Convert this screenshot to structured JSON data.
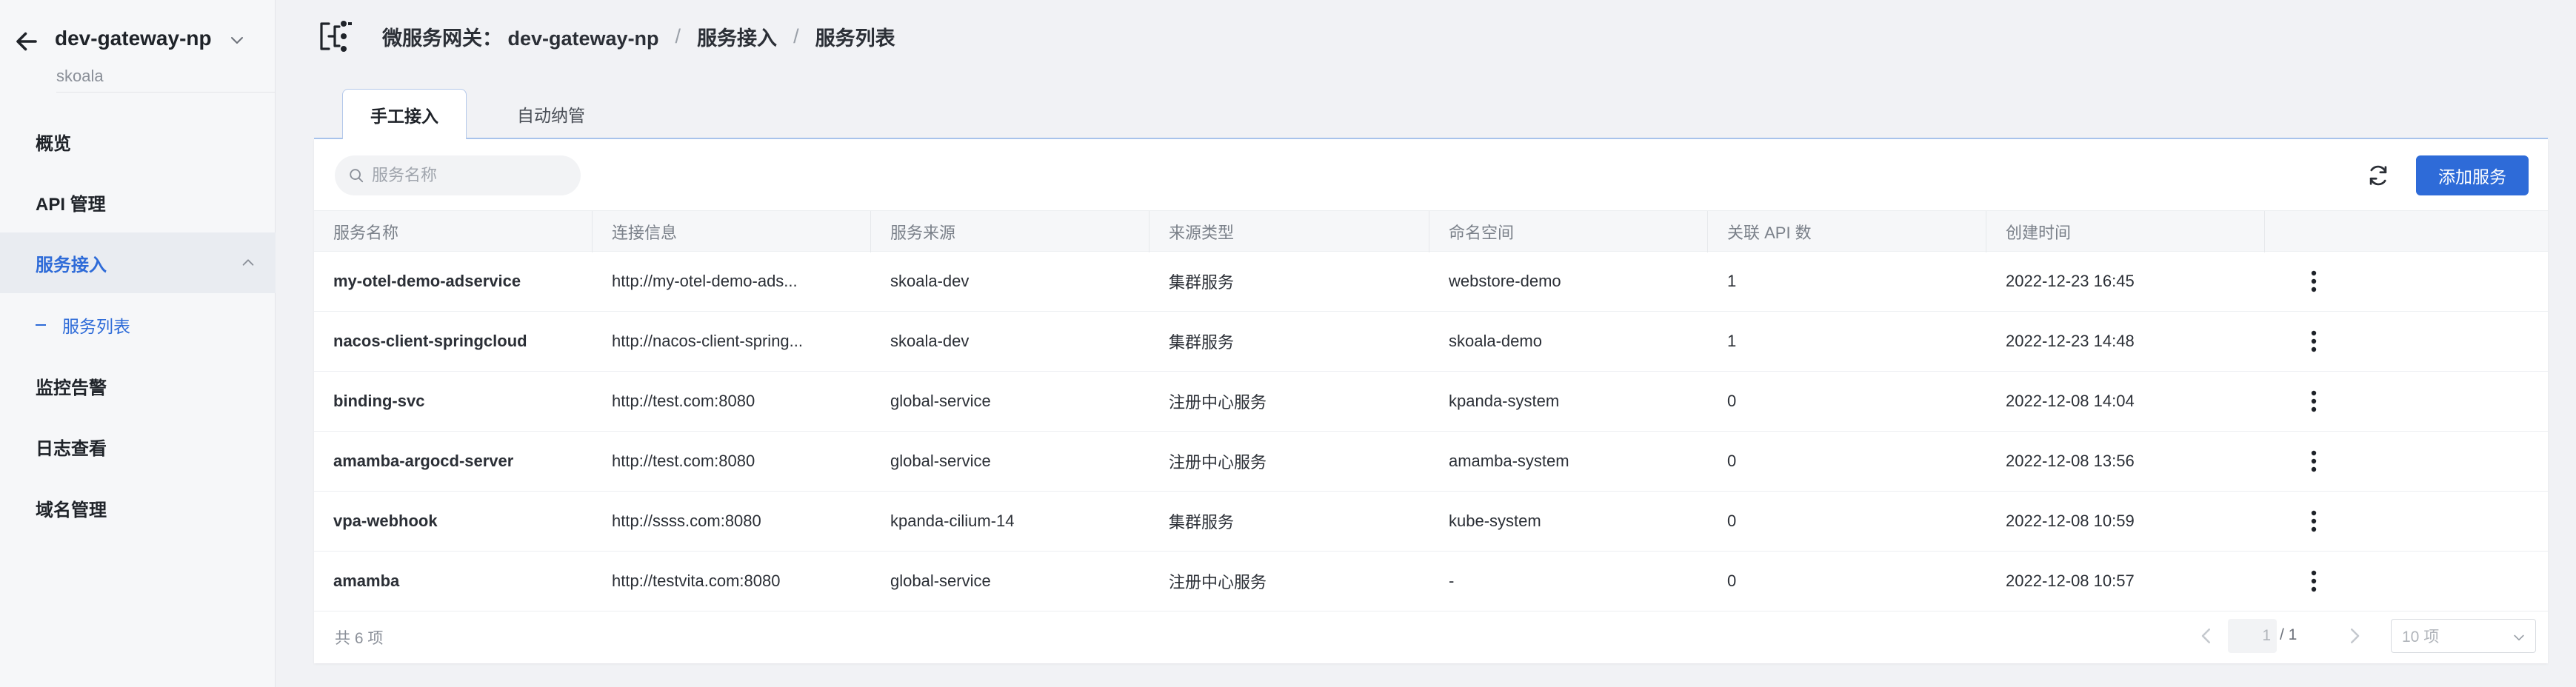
{
  "sidebar": {
    "app_name": "dev-gateway-np",
    "app_sub": "skoala",
    "items": [
      {
        "label": "概览"
      },
      {
        "label": "API 管理"
      },
      {
        "label": "服务接入"
      },
      {
        "label": "服务列表"
      },
      {
        "label": "监控告警"
      },
      {
        "label": "日志查看"
      },
      {
        "label": "域名管理"
      }
    ]
  },
  "breadcrumb": {
    "gateway": "微服务网关： dev-gateway-np",
    "section": "服务接入",
    "page": "服务列表",
    "separator": "/"
  },
  "tabs": [
    {
      "label": "手工接入",
      "active": true
    },
    {
      "label": "自动纳管",
      "active": false
    }
  ],
  "toolbar": {
    "search_placeholder": "服务名称",
    "add_label": "添加服务"
  },
  "table": {
    "headers": [
      "服务名称",
      "连接信息",
      "服务来源",
      "来源类型",
      "命名空间",
      "关联 API 数",
      "创建时间",
      ""
    ],
    "rows": [
      [
        "my-otel-demo-adservice",
        "http://my-otel-demo-ads...",
        "skoala-dev",
        "集群服务",
        "webstore-demo",
        "1",
        "2022-12-23 16:45"
      ],
      [
        "nacos-client-springcloud",
        "http://nacos-client-spring...",
        "skoala-dev",
        "集群服务",
        "skoala-demo",
        "1",
        "2022-12-23 14:48"
      ],
      [
        "binding-svc",
        "http://test.com:8080",
        "global-service",
        "注册中心服务",
        "kpanda-system",
        "0",
        "2022-12-08 14:04"
      ],
      [
        "amamba-argocd-server",
        "http://test.com:8080",
        "global-service",
        "注册中心服务",
        "amamba-system",
        "0",
        "2022-12-08 13:56"
      ],
      [
        "vpa-webhook",
        "http://ssss.com:8080",
        "kpanda-cilium-14",
        "集群服务",
        "kube-system",
        "0",
        "2022-12-08 10:59"
      ],
      [
        "amamba",
        "http://testvita.com:8080",
        "global-service",
        "注册中心服务",
        "-",
        "0",
        "2022-12-08 10:57"
      ]
    ]
  },
  "pagination": {
    "total_text": "共 6 项",
    "current_page": "1",
    "total_pages": "/ 1",
    "page_size": "10 项"
  },
  "colors": {
    "accent": "#2e6bd8",
    "sidebar_bg": "#f6f7f9",
    "page_bg": "#f1f2f5"
  }
}
